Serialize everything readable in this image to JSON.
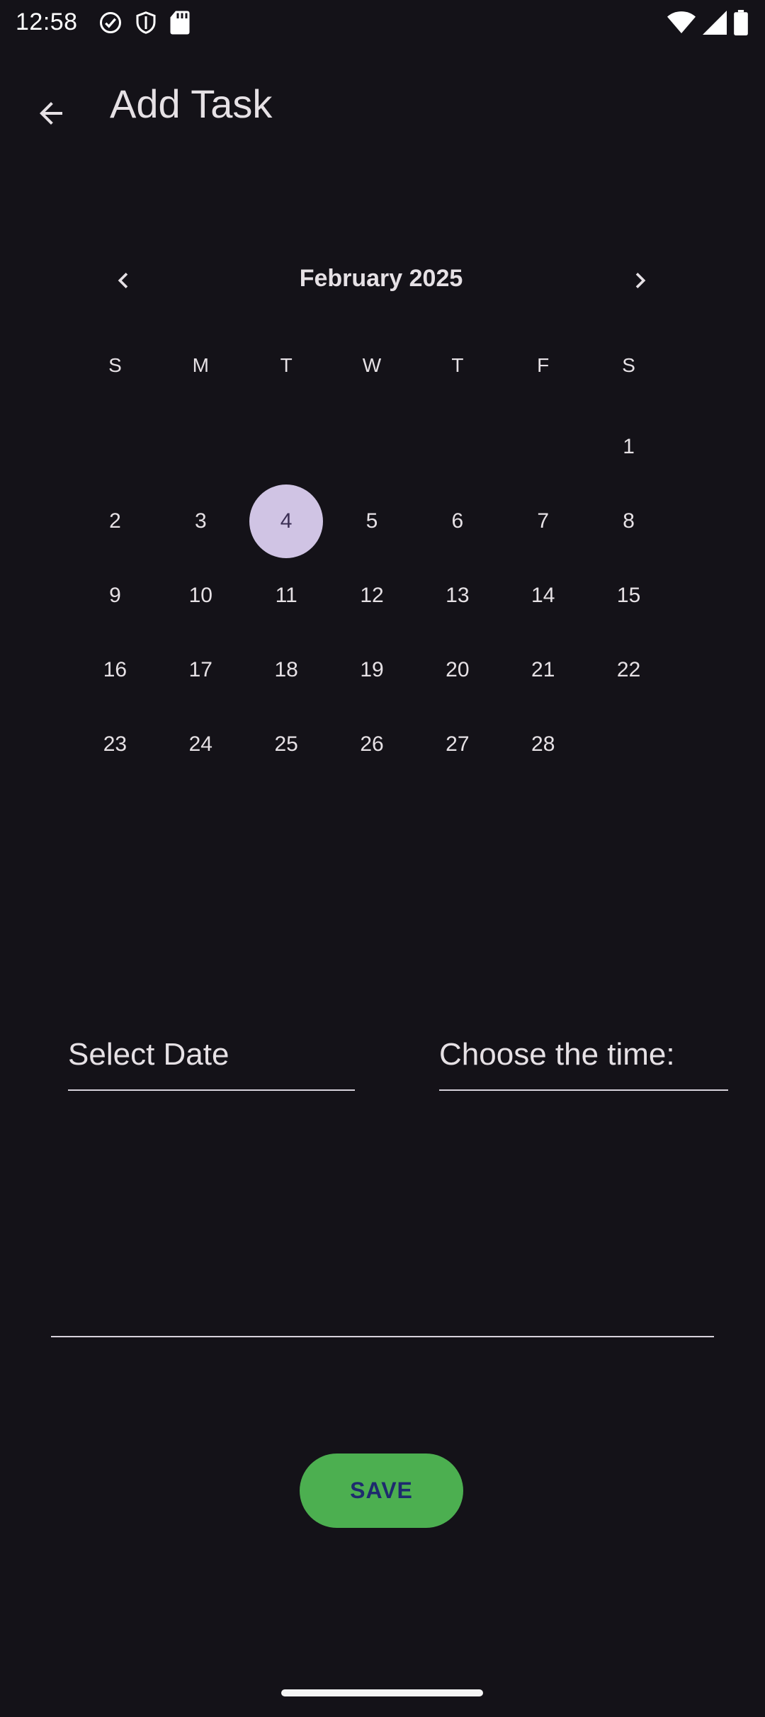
{
  "status_bar": {
    "time": "12:58",
    "left_icons": [
      "check-circle-icon",
      "shield-icon",
      "sd-card-icon"
    ],
    "right_icons": [
      "wifi-icon",
      "signal-icon",
      "battery-icon"
    ]
  },
  "toolbar": {
    "back_icon": "arrow-back-icon",
    "title": "Add Task"
  },
  "calendar": {
    "month_label": "February 2025",
    "prev_icon": "chevron-left-icon",
    "next_icon": "chevron-right-icon",
    "weekdays": [
      "S",
      "M",
      "T",
      "W",
      "T",
      "F",
      "S"
    ],
    "weeks": [
      [
        "",
        "",
        "",
        "",
        "",
        "",
        "1"
      ],
      [
        "2",
        "3",
        "4",
        "5",
        "6",
        "7",
        "8"
      ],
      [
        "9",
        "10",
        "11",
        "12",
        "13",
        "14",
        "15"
      ],
      [
        "16",
        "17",
        "18",
        "19",
        "20",
        "21",
        "22"
      ],
      [
        "23",
        "24",
        "25",
        "26",
        "27",
        "28",
        ""
      ]
    ],
    "selected_day": "4",
    "selected_color": "#d0c4e4"
  },
  "form": {
    "date_label": "Select Date",
    "time_label": "Choose the time:",
    "task_value": ""
  },
  "actions": {
    "save_label": "SAVE",
    "save_color": "#4caf50"
  }
}
